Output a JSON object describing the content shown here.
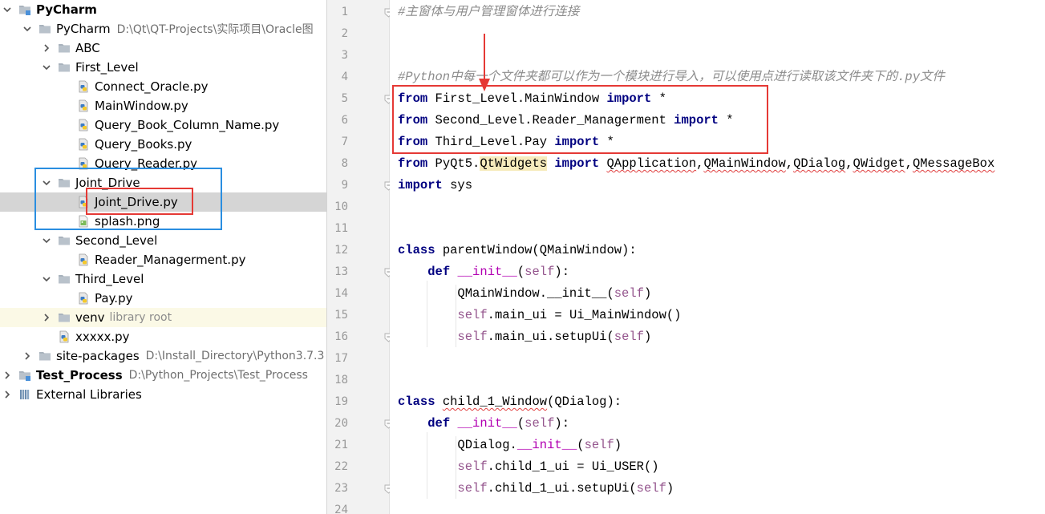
{
  "tree": {
    "rows": [
      {
        "label": "PyCharm",
        "path": "",
        "bold": true,
        "level": 0,
        "arrow": "down",
        "icon": "project-folder-icon"
      },
      {
        "label": "PyCharm",
        "path": "D:\\Qt\\QT-Projects\\实际项目\\Oracle图",
        "bold": false,
        "level": 1,
        "arrow": "down",
        "icon": "folder-icon"
      },
      {
        "label": "ABC",
        "path": "",
        "level": 2,
        "arrow": "right",
        "icon": "folder-icon"
      },
      {
        "label": "First_Level",
        "path": "",
        "level": 2,
        "arrow": "down",
        "icon": "folder-icon"
      },
      {
        "label": "Connect_Oracle.py",
        "path": "",
        "level": 3,
        "arrow": "",
        "icon": "python-file-icon"
      },
      {
        "label": "MainWindow.py",
        "path": "",
        "level": 3,
        "arrow": "",
        "icon": "python-file-icon"
      },
      {
        "label": "Query_Book_Column_Name.py",
        "path": "",
        "level": 3,
        "arrow": "",
        "icon": "python-file-icon"
      },
      {
        "label": "Query_Books.py",
        "path": "",
        "level": 3,
        "arrow": "",
        "icon": "python-file-icon"
      },
      {
        "label": "Query_Reader.py",
        "path": "",
        "level": 3,
        "arrow": "",
        "icon": "python-file-icon"
      },
      {
        "label": "Joint_Drive",
        "path": "",
        "level": 2,
        "arrow": "down",
        "icon": "folder-icon"
      },
      {
        "label": "Joint_Drive.py",
        "path": "",
        "level": 3,
        "arrow": "",
        "icon": "python-file-icon",
        "selected": true
      },
      {
        "label": "splash.png",
        "path": "",
        "level": 3,
        "arrow": "",
        "icon": "image-file-icon"
      },
      {
        "label": "Second_Level",
        "path": "",
        "level": 2,
        "arrow": "down",
        "icon": "folder-icon"
      },
      {
        "label": "Reader_Managerment.py",
        "path": "",
        "level": 3,
        "arrow": "",
        "icon": "python-file-icon"
      },
      {
        "label": "Third_Level",
        "path": "",
        "level": 2,
        "arrow": "down",
        "icon": "folder-icon"
      },
      {
        "label": "Pay.py",
        "path": "",
        "level": 3,
        "arrow": "",
        "icon": "python-file-icon"
      },
      {
        "label": "venv",
        "path": "library root",
        "level": 2,
        "arrow": "right",
        "icon": "folder-icon",
        "venv": true
      },
      {
        "label": "xxxxx.py",
        "path": "",
        "level": 2,
        "arrow": "",
        "icon": "python-file-icon"
      },
      {
        "label": "site-packages",
        "path": "D:\\Install_Directory\\Python3.7.3",
        "level": 1,
        "arrow": "right",
        "icon": "folder-icon"
      },
      {
        "label": "Test_Process",
        "path": "D:\\Python_Projects\\Test_Process",
        "bold": true,
        "level": 0,
        "arrow": "right",
        "icon": "project-folder-icon"
      },
      {
        "label": "External Libraries",
        "path": "",
        "level": 0,
        "arrow": "right",
        "icon": "library-icon"
      }
    ]
  },
  "editor": {
    "line_numbers": [
      "1",
      "2",
      "3",
      "4",
      "5",
      "6",
      "7",
      "8",
      "9",
      "10",
      "11",
      "12",
      "13",
      "14",
      "15",
      "16",
      "17",
      "18",
      "19",
      "20",
      "21",
      "22",
      "23",
      "24"
    ],
    "lines": [
      [
        {
          "t": "#主窗体与用户管理窗体进行连接",
          "c": "cmt"
        }
      ],
      [],
      [],
      [
        {
          "t": "#Python中每一个文件夹都可以作为一个模块进行导入，可以使用点进行读取该文件夹下的.py文件",
          "c": "cmt"
        }
      ],
      [
        {
          "t": "from",
          "c": "kw"
        },
        {
          "t": " First_Level.MainWindow "
        },
        {
          "t": "import",
          "c": "kw"
        },
        {
          "t": " *"
        }
      ],
      [
        {
          "t": "from",
          "c": "kw"
        },
        {
          "t": " Second_Level.Reader_Managerment "
        },
        {
          "t": "import",
          "c": "kw"
        },
        {
          "t": " *"
        }
      ],
      [
        {
          "t": "from",
          "c": "kw"
        },
        {
          "t": " Third_Level.Pay "
        },
        {
          "t": "import",
          "c": "kw"
        },
        {
          "t": " *"
        }
      ],
      [
        {
          "t": "from",
          "c": "kw"
        },
        {
          "t": " PyQt5."
        },
        {
          "t": "QtWidgets",
          "c": "hlmod"
        },
        {
          "t": " "
        },
        {
          "t": "import",
          "c": "kw"
        },
        {
          "t": " "
        },
        {
          "t": "QApplication",
          "c": "wavy"
        },
        {
          "t": ","
        },
        {
          "t": "QMainWindow",
          "c": "wavy"
        },
        {
          "t": ","
        },
        {
          "t": "QDialog",
          "c": "wavy"
        },
        {
          "t": ","
        },
        {
          "t": "QWidget",
          "c": "wavy"
        },
        {
          "t": ","
        },
        {
          "t": "QMessageBox",
          "c": "wavy"
        }
      ],
      [
        {
          "t": "import",
          "c": "kw"
        },
        {
          "t": " sys"
        }
      ],
      [],
      [],
      [
        {
          "t": "class",
          "c": "kw"
        },
        {
          "t": " parentWindow(QMainWindow):"
        }
      ],
      [
        {
          "t": "    "
        },
        {
          "t": "def",
          "c": "kw"
        },
        {
          "t": " "
        },
        {
          "t": "__init__",
          "c": "mag"
        },
        {
          "t": "("
        },
        {
          "t": "self",
          "c": "slf"
        },
        {
          "t": "):"
        }
      ],
      [
        {
          "t": "        QMainWindow.__init__("
        },
        {
          "t": "self",
          "c": "slf"
        },
        {
          "t": ")"
        }
      ],
      [
        {
          "t": "        "
        },
        {
          "t": "self",
          "c": "slf"
        },
        {
          "t": ".main_ui = Ui_MainWindow()"
        }
      ],
      [
        {
          "t": "        "
        },
        {
          "t": "self",
          "c": "slf"
        },
        {
          "t": ".main_ui.setupUi("
        },
        {
          "t": "self",
          "c": "slf"
        },
        {
          "t": ")"
        }
      ],
      [],
      [],
      [
        {
          "t": "class",
          "c": "kw"
        },
        {
          "t": " "
        },
        {
          "t": "child_1_Window",
          "c": "wavy"
        },
        {
          "t": "(QDialog):"
        }
      ],
      [
        {
          "t": "    "
        },
        {
          "t": "def",
          "c": "kw"
        },
        {
          "t": " "
        },
        {
          "t": "__init__",
          "c": "mag"
        },
        {
          "t": "("
        },
        {
          "t": "self",
          "c": "slf"
        },
        {
          "t": "):"
        }
      ],
      [
        {
          "t": "        QDialog."
        },
        {
          "t": "__init__",
          "c": "mag"
        },
        {
          "t": "("
        },
        {
          "t": "self",
          "c": "slf"
        },
        {
          "t": ")"
        }
      ],
      [
        {
          "t": "        "
        },
        {
          "t": "self",
          "c": "slf"
        },
        {
          "t": ".child_1_ui = Ui_USER()"
        }
      ],
      [
        {
          "t": "        "
        },
        {
          "t": "self",
          "c": "slf"
        },
        {
          "t": ".child_1_ui.setupUi("
        },
        {
          "t": "self",
          "c": "slf"
        },
        {
          "t": ")"
        }
      ],
      []
    ],
    "fold_markers": [
      "1",
      "5",
      "9",
      "13",
      "16",
      "20",
      "23"
    ]
  },
  "colors": {
    "keyword": "#000080",
    "comment": "#8c8c8c",
    "self": "#94558d",
    "magic": "#b200b2",
    "annotation_red": "#e53935",
    "annotation_blue": "#2a8ee0"
  }
}
